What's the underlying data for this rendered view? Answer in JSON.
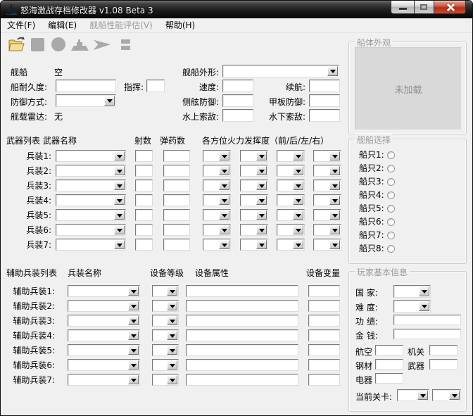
{
  "window": {
    "title": "怒海激战存档修改器 v1.08 Beta 3"
  },
  "colors": {
    "background": "#f0f0f0",
    "titlebar": "#1c1c1c",
    "close_button": "#b92d17",
    "folder_icon": "#e8a33d",
    "disabled_text": "#9a9a9a"
  },
  "menu": {
    "items": [
      {
        "label": "文件(F)",
        "enabled": true
      },
      {
        "label": "编辑(E)",
        "enabled": true
      },
      {
        "label": "舰船性能评估(V)",
        "enabled": false
      },
      {
        "label": "帮助(H)",
        "enabled": true
      }
    ]
  },
  "toolbar": {
    "buttons": [
      {
        "icon": "open-folder-icon",
        "enabled": true
      },
      {
        "icon": "square-icon",
        "enabled": false
      },
      {
        "icon": "circle-icon",
        "enabled": false
      },
      {
        "icon": "ship-icon",
        "enabled": false
      },
      {
        "icon": "arrow-icon",
        "enabled": false
      },
      {
        "icon": "small-box-icon",
        "enabled": false
      }
    ]
  },
  "ship_info": {
    "ship_label": "舰船",
    "ship_value": "空",
    "durability_label": "船耐久度:",
    "command_label": "指挥:",
    "defense_mode_label": "防御方式:",
    "radar_label": "舰载雷达:",
    "radar_value": "无",
    "shape_label": "舰船外形:",
    "speed_label": "速度:",
    "endurance_label": "续航:",
    "side_defense_label": "侧舷防御:",
    "deck_defense_label": "甲板防御:",
    "surface_detect_label": "水上索敌:",
    "underwater_detect_label": "水下索敌:"
  },
  "weapons": {
    "section_label": "武器列表",
    "headers": {
      "name": "武器名称",
      "shots": "射数",
      "ammo": "弹药数",
      "fire": "各方位火力发挥度（前/后/左/右）"
    },
    "rows": [
      {
        "label": "兵装1:"
      },
      {
        "label": "兵装2:"
      },
      {
        "label": "兵装3:"
      },
      {
        "label": "兵装4:"
      },
      {
        "label": "兵装5:"
      },
      {
        "label": "兵装6:"
      },
      {
        "label": "兵装7:"
      }
    ]
  },
  "aux": {
    "section_label": "辅助兵装列表",
    "headers": {
      "name": "兵装名称",
      "level": "设备等级",
      "attr": "设备属性",
      "variable": "设备变量"
    },
    "rows": [
      {
        "label": "辅助兵装1:"
      },
      {
        "label": "辅助兵装2:"
      },
      {
        "label": "辅助兵装3:"
      },
      {
        "label": "辅助兵装4:"
      },
      {
        "label": "辅助兵装5:"
      },
      {
        "label": "辅助兵装6:"
      },
      {
        "label": "辅助兵装7:"
      }
    ]
  },
  "hull": {
    "title": "船体外观",
    "placeholder": "未加载"
  },
  "ship_select": {
    "title": "舰船选择",
    "items": [
      {
        "label": "船只1:"
      },
      {
        "label": "船只2:"
      },
      {
        "label": "船只3:"
      },
      {
        "label": "船只4:"
      },
      {
        "label": "船只5:"
      },
      {
        "label": "船只6:"
      },
      {
        "label": "船只7:"
      },
      {
        "label": "船只8:"
      }
    ]
  },
  "player": {
    "title": "玩家基本信息",
    "country_label": "国 家:",
    "difficulty_label": "难 度:",
    "merit_label": "功 绩:",
    "money_label": "金 钱:",
    "aviation_label": "航空",
    "machinery_label": "机关",
    "steel_label": "钢材",
    "weapon_label": "武器",
    "electronics_label": "电器",
    "stage_label": "当前关卡:"
  }
}
